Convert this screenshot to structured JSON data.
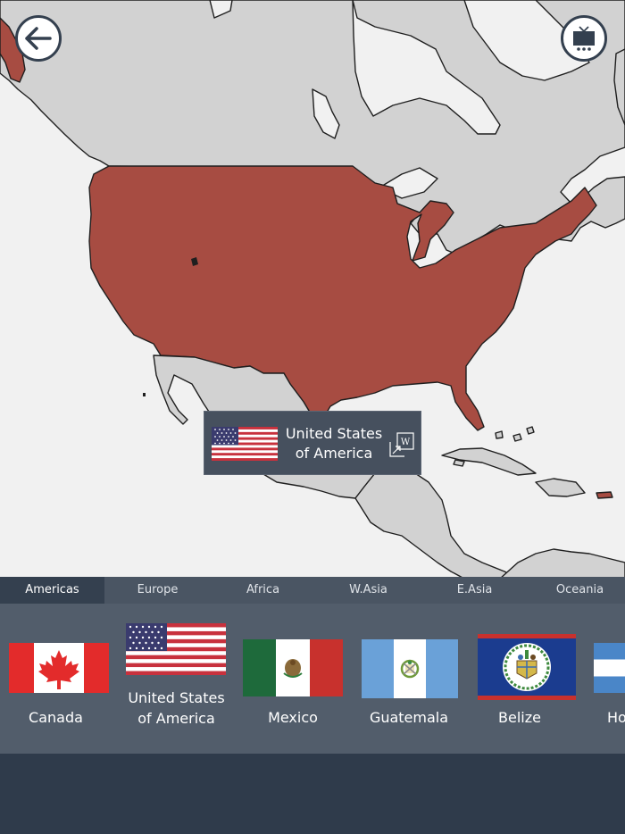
{
  "map": {
    "highlight_color": "#a74c42",
    "land_color": "#d2d2d2",
    "water_color": "#f1f1f1",
    "border_color": "#1f1f1f"
  },
  "header": {
    "back_icon": "arrow-left-icon",
    "tv_icon": "tv-icon"
  },
  "tooltip": {
    "country_name": "United States\nof America",
    "wiki_icon": "wikipedia-icon"
  },
  "tabs": [
    {
      "label": "Americas",
      "active": true
    },
    {
      "label": "Europe",
      "active": false
    },
    {
      "label": "Africa",
      "active": false
    },
    {
      "label": "W.Asia",
      "active": false
    },
    {
      "label": "E.Asia",
      "active": false
    },
    {
      "label": "Oceania",
      "active": false
    }
  ],
  "flags": [
    {
      "label": "Canada"
    },
    {
      "label": "United States\nof America"
    },
    {
      "label": "Mexico"
    },
    {
      "label": "Guatemala"
    },
    {
      "label": "Belize"
    },
    {
      "label": "Ho"
    }
  ],
  "colors": {
    "panel": "#525d6b",
    "tab_active": "#34404f",
    "bottom": "#2f3b4b"
  }
}
